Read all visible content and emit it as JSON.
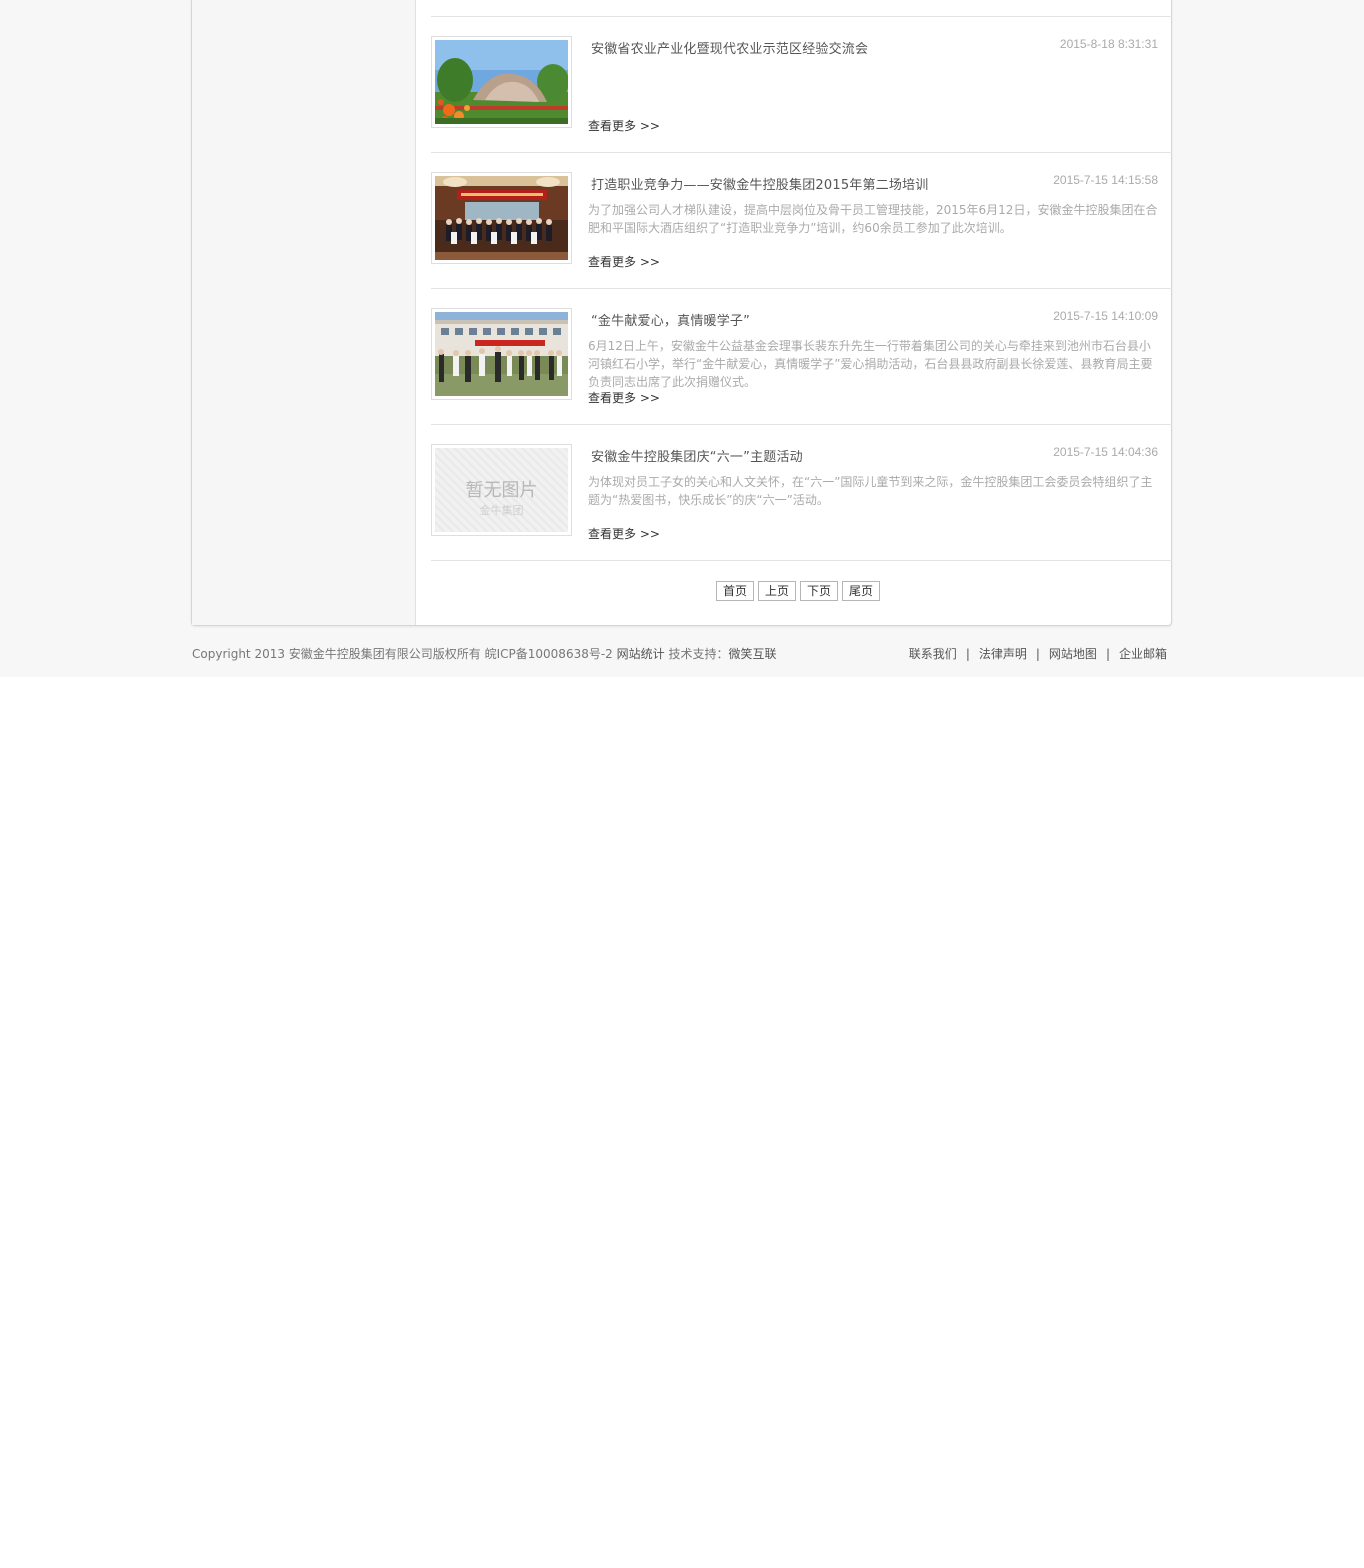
{
  "news": [
    {
      "title": "安徽省农业产业化暨现代农业示范区经验交流会",
      "date": "2015-8-18 8:31:31",
      "summary": "",
      "more": "查看更多 >>",
      "thumb": "park-garden-photo"
    },
    {
      "title": "打造职业竞争力——安徽金牛控股集团2015年第二场培训",
      "date": "2015-7-15 14:15:58",
      "summary": "为了加强公司人才梯队建设，提高中层岗位及骨干员工管理技能，2015年6月12日，安徽金牛控股集团在合肥和平国际大酒店组织了“打造职业竞争力”培训，约60余员工参加了此次培训。",
      "more": "查看更多 >>",
      "thumb": "group-photo-hall"
    },
    {
      "title": "“金牛献爱心，真情暖学子”",
      "date": "2015-7-15 14:10:09",
      "summary": "6月12日上午，安徽金牛公益基金会理事长裴东升先生一行带着集团公司的关心与牵挂来到池州市石台县小河镇红石小学，举行“金牛献爱心，真情暖学子”爱心捐助活动，石台县县政府副县长徐爱莲、县教育局主要负责同志出席了此次捐赠仪式。",
      "more": "查看更多 >>",
      "thumb": "school-donation-photo"
    },
    {
      "title": "安徽金牛控股集团庆“六一”主题活动",
      "date": "2015-7-15 14:04:36",
      "summary": "为体现对员工子女的关心和人文关怀，在“六一”国际儿童节到来之际，金牛控股集团工会委员会特组织了主题为“热爱图书，快乐成长”的庆“六一”活动。",
      "more": "查看更多 >>",
      "thumb": "no-image-placeholder",
      "placeholder_main": "暂无图片",
      "placeholder_sub": "金牛集团"
    }
  ],
  "pager": {
    "first": "首页",
    "prev": "上页",
    "next": "下页",
    "last": "尾页"
  },
  "footer": {
    "copyright": "Copyright 2013 安徽金牛控股集团有限公司版权所有 皖ICP备10008638号-2",
    "stats": "网站统计",
    "support_label": "技术支持：",
    "support_name": "微笑互联",
    "links": [
      "联系我们",
      "法律声明",
      "网站地图",
      "企业邮箱"
    ],
    "separator": "|"
  }
}
